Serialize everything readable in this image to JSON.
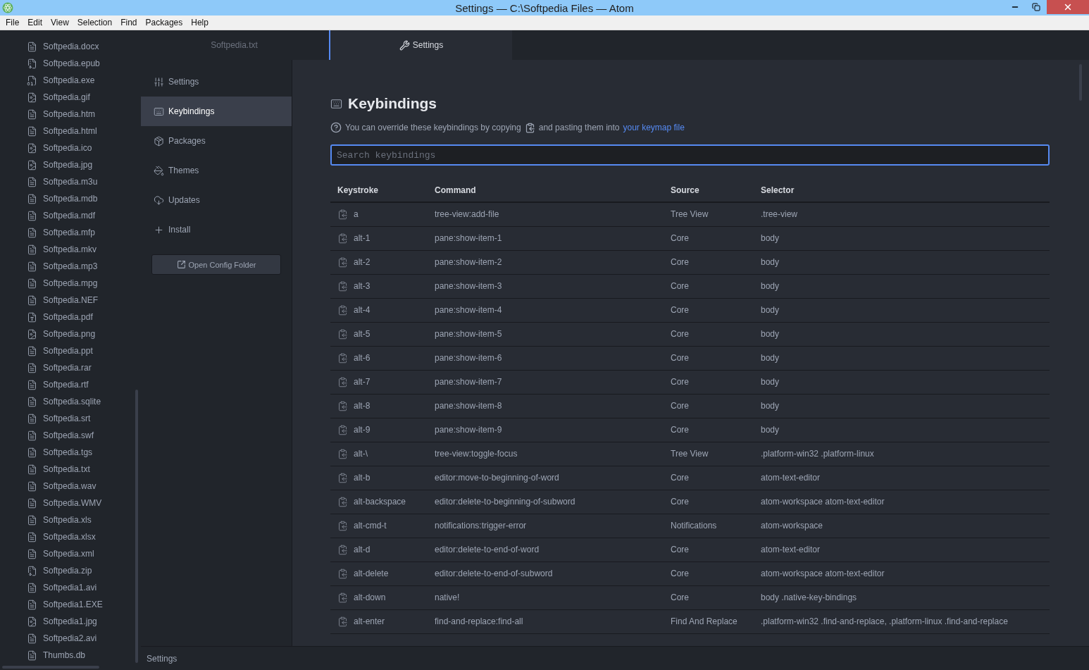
{
  "window": {
    "title": "Settings — C:\\Softpedia Files — Atom"
  },
  "menu": [
    "File",
    "Edit",
    "View",
    "Selection",
    "Find",
    "Packages",
    "Help"
  ],
  "tree": [
    {
      "name": "Softpedia.docx",
      "kind": "text"
    },
    {
      "name": "Softpedia.epub",
      "kind": "zip"
    },
    {
      "name": "Softpedia.exe",
      "kind": "binary"
    },
    {
      "name": "Softpedia.gif",
      "kind": "image"
    },
    {
      "name": "Softpedia.htm",
      "kind": "text"
    },
    {
      "name": "Softpedia.html",
      "kind": "text"
    },
    {
      "name": "Softpedia.ico",
      "kind": "image"
    },
    {
      "name": "Softpedia.jpg",
      "kind": "image"
    },
    {
      "name": "Softpedia.m3u",
      "kind": "text"
    },
    {
      "name": "Softpedia.mdb",
      "kind": "text"
    },
    {
      "name": "Softpedia.mdf",
      "kind": "text"
    },
    {
      "name": "Softpedia.mfp",
      "kind": "text"
    },
    {
      "name": "Softpedia.mkv",
      "kind": "text"
    },
    {
      "name": "Softpedia.mp3",
      "kind": "text"
    },
    {
      "name": "Softpedia.mpg",
      "kind": "text"
    },
    {
      "name": "Softpedia.NEF",
      "kind": "text"
    },
    {
      "name": "Softpedia.pdf",
      "kind": "pdf"
    },
    {
      "name": "Softpedia.png",
      "kind": "image"
    },
    {
      "name": "Softpedia.ppt",
      "kind": "text"
    },
    {
      "name": "Softpedia.rar",
      "kind": "text"
    },
    {
      "name": "Softpedia.rtf",
      "kind": "text"
    },
    {
      "name": "Softpedia.sqlite",
      "kind": "text"
    },
    {
      "name": "Softpedia.srt",
      "kind": "text"
    },
    {
      "name": "Softpedia.swf",
      "kind": "text"
    },
    {
      "name": "Softpedia.tgs",
      "kind": "text"
    },
    {
      "name": "Softpedia.txt",
      "kind": "text"
    },
    {
      "name": "Softpedia.wav",
      "kind": "text"
    },
    {
      "name": "Softpedia.WMV",
      "kind": "text"
    },
    {
      "name": "Softpedia.xls",
      "kind": "text"
    },
    {
      "name": "Softpedia.xlsx",
      "kind": "text"
    },
    {
      "name": "Softpedia.xml",
      "kind": "text"
    },
    {
      "name": "Softpedia.zip",
      "kind": "zip"
    },
    {
      "name": "Softpedia1.avi",
      "kind": "text"
    },
    {
      "name": "Softpedia1.EXE",
      "kind": "text"
    },
    {
      "name": "Softpedia1.jpg",
      "kind": "image"
    },
    {
      "name": "Softpedia2.avi",
      "kind": "text"
    },
    {
      "name": "Thumbs.db",
      "kind": "text"
    }
  ],
  "tabs": [
    {
      "label": "Softpedia.txt",
      "selected": false,
      "kind": "file"
    },
    {
      "label": "Settings",
      "selected": true,
      "kind": "settings"
    }
  ],
  "settings_menu": [
    {
      "label": "Settings",
      "selected": false,
      "kind": "settings"
    },
    {
      "label": "Keybindings",
      "selected": true,
      "kind": "keybindings"
    },
    {
      "label": "Packages",
      "selected": false,
      "kind": "packages"
    },
    {
      "label": "Themes",
      "selected": false,
      "kind": "themes"
    },
    {
      "label": "Updates",
      "selected": false,
      "kind": "updates"
    },
    {
      "label": "Install",
      "selected": false,
      "kind": "install"
    }
  ],
  "open_config_button": "Open Config Folder",
  "heading": "Keybindings",
  "hint": {
    "before": "You can override these keybindings by copying",
    "after": "and pasting them into",
    "link": "your keymap file"
  },
  "search": {
    "placeholder": "Search keybindings"
  },
  "table": {
    "columns": [
      "Keystroke",
      "Command",
      "Source",
      "Selector"
    ],
    "rows": [
      [
        "a",
        "tree-view:add-file",
        "Tree View",
        ".tree-view"
      ],
      [
        "alt-1",
        "pane:show-item-1",
        "Core",
        "body"
      ],
      [
        "alt-2",
        "pane:show-item-2",
        "Core",
        "body"
      ],
      [
        "alt-3",
        "pane:show-item-3",
        "Core",
        "body"
      ],
      [
        "alt-4",
        "pane:show-item-4",
        "Core",
        "body"
      ],
      [
        "alt-5",
        "pane:show-item-5",
        "Core",
        "body"
      ],
      [
        "alt-6",
        "pane:show-item-6",
        "Core",
        "body"
      ],
      [
        "alt-7",
        "pane:show-item-7",
        "Core",
        "body"
      ],
      [
        "alt-8",
        "pane:show-item-8",
        "Core",
        "body"
      ],
      [
        "alt-9",
        "pane:show-item-9",
        "Core",
        "body"
      ],
      [
        "alt-\\",
        "tree-view:toggle-focus",
        "Tree View",
        ".platform-win32 .platform-linux"
      ],
      [
        "alt-b",
        "editor:move-to-beginning-of-word",
        "Core",
        "atom-text-editor"
      ],
      [
        "alt-backspace",
        "editor:delete-to-beginning-of-subword",
        "Core",
        "atom-workspace atom-text-editor"
      ],
      [
        "alt-cmd-t",
        "notifications:trigger-error",
        "Notifications",
        "atom-workspace"
      ],
      [
        "alt-d",
        "editor:delete-to-end-of-word",
        "Core",
        "atom-text-editor"
      ],
      [
        "alt-delete",
        "editor:delete-to-end-of-subword",
        "Core",
        "atom-workspace atom-text-editor"
      ],
      [
        "alt-down",
        "native!",
        "Core",
        "body .native-key-bindings"
      ],
      [
        "alt-enter",
        "find-and-replace:find-all",
        "Find And Replace",
        ".platform-win32 .find-and-replace, .platform-linux .find-and-replace"
      ]
    ]
  },
  "status_bar": {
    "text": "Settings"
  }
}
